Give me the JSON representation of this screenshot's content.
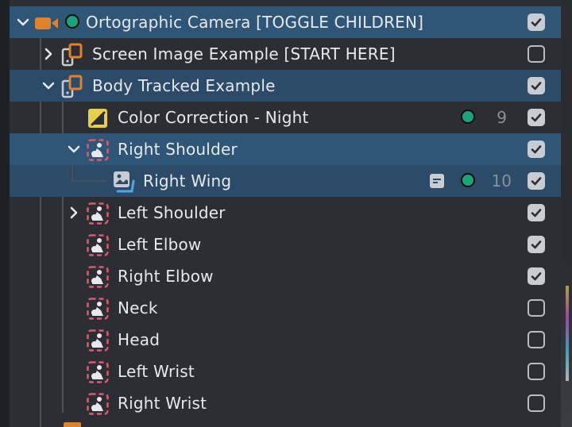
{
  "tree": {
    "camera": {
      "label": "Ortographic Camera [TOGGLE CHILDREN]",
      "icon": "camera-icon",
      "status_color": "#1aa57a",
      "checked": true
    },
    "screen_image": {
      "label": "Screen Image Example [START HERE]",
      "icon": "device-object-icon",
      "checked": false
    },
    "body_tracked": {
      "label": "Body Tracked Example",
      "icon": "device-object-icon",
      "checked": true
    },
    "color_correction": {
      "label": "Color Correction - Night",
      "icon": "color-correction-icon",
      "count": "9",
      "checked": true
    },
    "right_shoulder": {
      "label": "Right Shoulder",
      "icon": "body-joint-icon",
      "checked": true
    },
    "right_wing": {
      "label": "Right Wing",
      "icon": "image-layer-icon",
      "count": "10",
      "checked": true
    },
    "joints": [
      {
        "label": "Left Shoulder",
        "checked": true,
        "has_children": true
      },
      {
        "label": "Left Elbow",
        "checked": true
      },
      {
        "label": "Right Elbow",
        "checked": true
      },
      {
        "label": "Neck",
        "checked": false
      },
      {
        "label": "Head",
        "checked": false
      },
      {
        "label": "Left Wrist",
        "checked": false
      },
      {
        "label": "Right Wrist",
        "checked": false
      }
    ]
  },
  "colors": {
    "accent_orange": "#e0812b",
    "status_green": "#1aa57a",
    "joint_red": "#e05a6a",
    "selection_blue": "#2f5676",
    "wing_blue": "#4aa9e8"
  }
}
